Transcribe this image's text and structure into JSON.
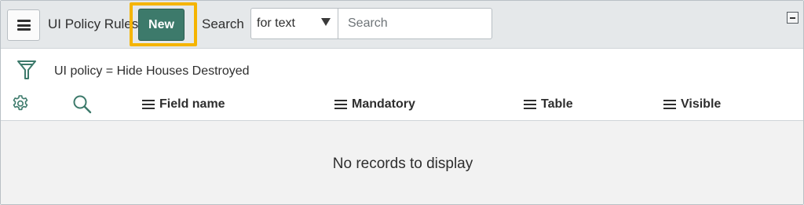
{
  "header": {
    "menu_icon": "hamburger-icon",
    "title": "UI Policy Rules",
    "new_label": "New",
    "search_label": "Search",
    "search_field": {
      "selected": "for text",
      "placeholder": "Search",
      "value": ""
    },
    "collapse_icon": "collapse-icon"
  },
  "filter": {
    "icon": "filter-icon",
    "text": "UI policy = Hide Houses Destroyed"
  },
  "table": {
    "settings_icon": "gear-icon",
    "search_icon": "magnifier-icon",
    "columns": [
      {
        "label": "Field name"
      },
      {
        "label": "Mandatory"
      },
      {
        "label": "Table"
      },
      {
        "label": "Visible"
      }
    ],
    "empty_message": "No records to display"
  },
  "colors": {
    "accent": "#3d7a6b",
    "highlight": "#f5b400",
    "header_bg": "#e5e8ea",
    "empty_bg": "#f2f2f2"
  }
}
